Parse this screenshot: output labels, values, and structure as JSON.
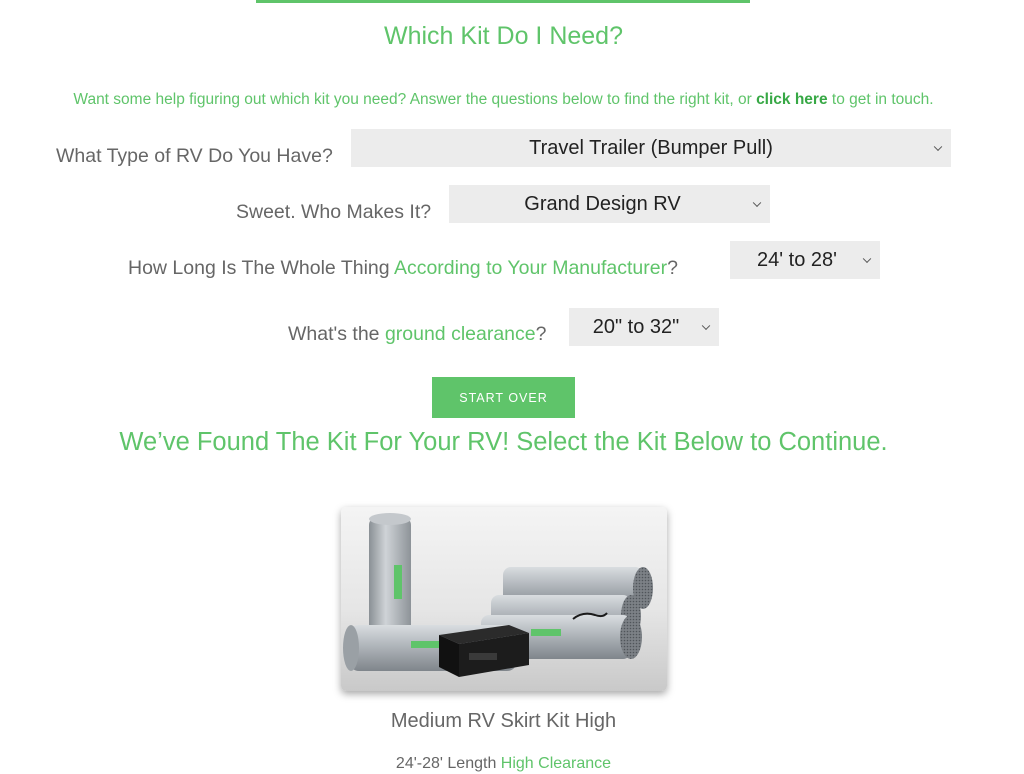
{
  "title": "Which Kit Do I Need?",
  "intro": {
    "before": "Want some help figuring out which kit you need? Answer the questions below to find the right kit, or ",
    "link": "click here",
    "after": " to get in touch."
  },
  "questions": [
    {
      "text": "What Type of RV Do You Have?",
      "value": "Travel Trailer (Bumper Pull)"
    },
    {
      "text": "Sweet. Who Makes It?",
      "value": "Grand Design RV"
    },
    {
      "text": "How Long Is The Whole Thing ",
      "highlight": "According to Your Manufacturer",
      "suffix": "?",
      "value": "24' to 28'"
    },
    {
      "text": "What's the ",
      "highlight": "ground clearance",
      "suffix": "?",
      "value": "20\" to 32\""
    }
  ],
  "start_over_label": "START OVER",
  "found_heading": "We’ve Found The Kit For Your RV! Select the Kit Below to Continue.",
  "product": {
    "name": "Medium RV Skirt Kit High",
    "spec_text": "24'-28' Length ",
    "spec_highlight": "High Clearance",
    "image_caption": "RV skirt kit cylinders and black control box"
  },
  "colors": {
    "accent": "#5fc46a",
    "text": "#666666",
    "select_bg": "#ececec"
  }
}
